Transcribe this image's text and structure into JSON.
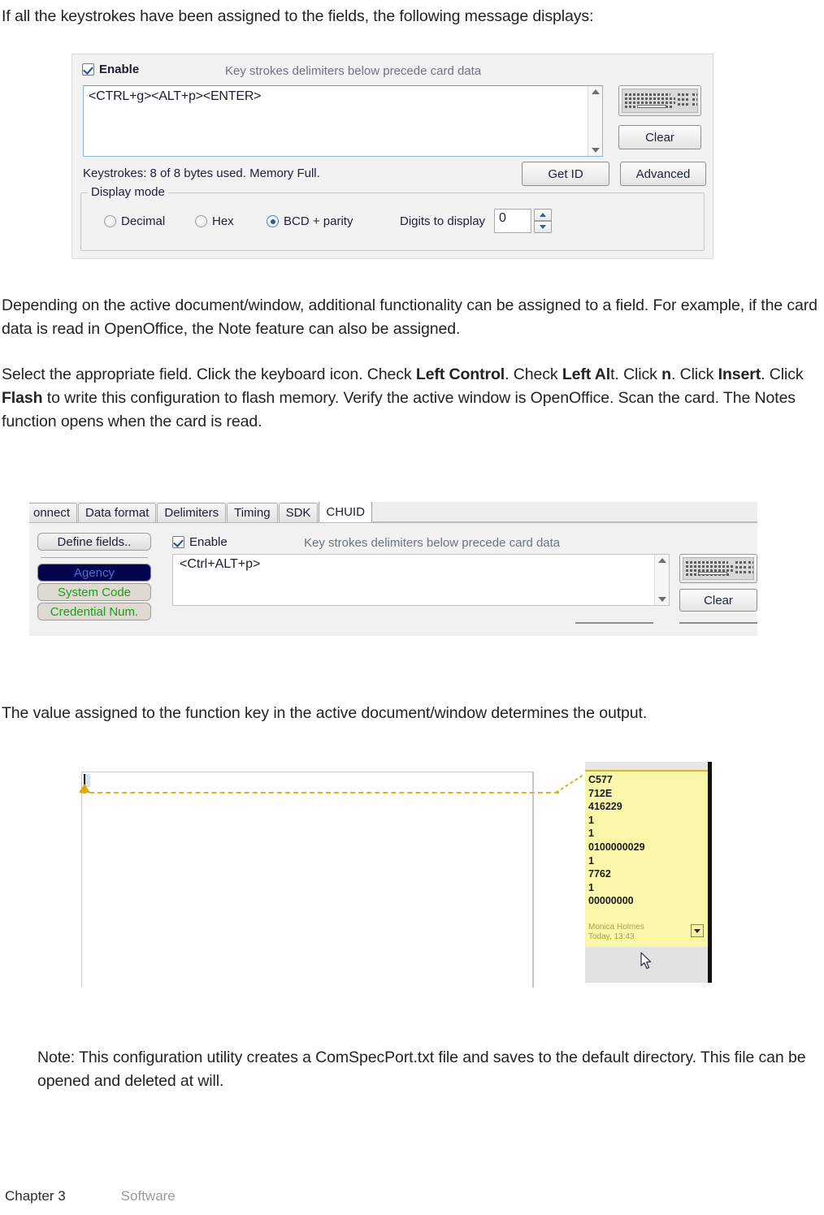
{
  "paragraphs": {
    "intro": "If all the keystrokes have been assigned to the fields, the following message displays:",
    "depending": "Depending on the active document/window, additional functionality can be assigned to a field. For example, if the card data is read in OpenOffice, the Note feature can also be assigned.",
    "value_assigned": "The value assigned to the function key in the active document/window determines the output.",
    "note_block": "Note: This configuration utility creates a ComSpecPort.txt file and saves to the default directory. This file can be opened and deleted at will."
  },
  "select_steps": {
    "p1": "Select the appropriate field. Click the keyboard icon. Check ",
    "b1": "Left Control",
    "p2": ". Check ",
    "b2": "Left Al",
    "p3": "t. Click ",
    "b3": "n",
    "p4": ". Click ",
    "b4": "Insert",
    "p5": ". Click ",
    "b5": "Flash",
    "p6": " to write this configuration to flash memory. Verify the active window is OpenOffice. Scan the card. The Notes function opens when the card is read."
  },
  "footer": {
    "chapter": "Chapter 3",
    "section": "Software"
  },
  "shot1": {
    "enable_label": "Enable",
    "enable_checked": true,
    "hint": "Key strokes delimiters below precede card data",
    "textarea_value": "<CTRL+g><ALT+p><ENTER>",
    "keyboard_icon": "keyboard-icon",
    "clear_label": "Clear",
    "keystrokes_status": "Keystrokes: 8 of 8 bytes used. Memory Full.",
    "get_id_label": "Get ID",
    "advanced_label": "Advanced",
    "display_mode_legend": "Display mode",
    "radios": [
      {
        "label": "Decimal",
        "selected": false
      },
      {
        "label": "Hex",
        "selected": false
      },
      {
        "label": "BCD + parity",
        "selected": true
      }
    ],
    "digits_label": "Digits to display",
    "digits_value": "0"
  },
  "shot2": {
    "tabs": [
      {
        "label": "onnect",
        "active": false
      },
      {
        "label": "Data format",
        "active": false
      },
      {
        "label": "Delimiters",
        "active": false
      },
      {
        "label": "Timing",
        "active": false
      },
      {
        "label": "SDK",
        "active": false
      },
      {
        "label": "CHUID",
        "active": true
      }
    ],
    "define_fields_label": "Define fields..",
    "field_buttons": [
      {
        "label": "Agency",
        "state": "selected",
        "text_color": "#4e6bd4",
        "bg_color": "#05054f"
      },
      {
        "label": "System Code",
        "state": "normal",
        "text_color": "#1a9e1a",
        "bg_color": "#dedad2"
      },
      {
        "label": "Credential Num.",
        "state": "normal",
        "text_color": "#1a9e1a",
        "bg_color": "#dedad2"
      }
    ],
    "enable_label": "Enable",
    "enable_checked": true,
    "hint": "Key strokes delimiters below precede card data",
    "textarea_value": "<Ctrl+ALT+p>",
    "keyboard_icon": "keyboard-icon",
    "clear_label": "Clear"
  },
  "shot3": {
    "note_lines": [
      "C577",
      "712E",
      "416229",
      "1",
      "1",
      "0100000029",
      "1",
      "7762",
      "1",
      "00000000"
    ],
    "note_author": "Monica Holmes",
    "note_timestamp": "Today, 13:43",
    "note_bg_color": "#fbf7aa",
    "anchor_color": "#e3a700",
    "cursor_icon": "mouse-pointer-icon"
  }
}
